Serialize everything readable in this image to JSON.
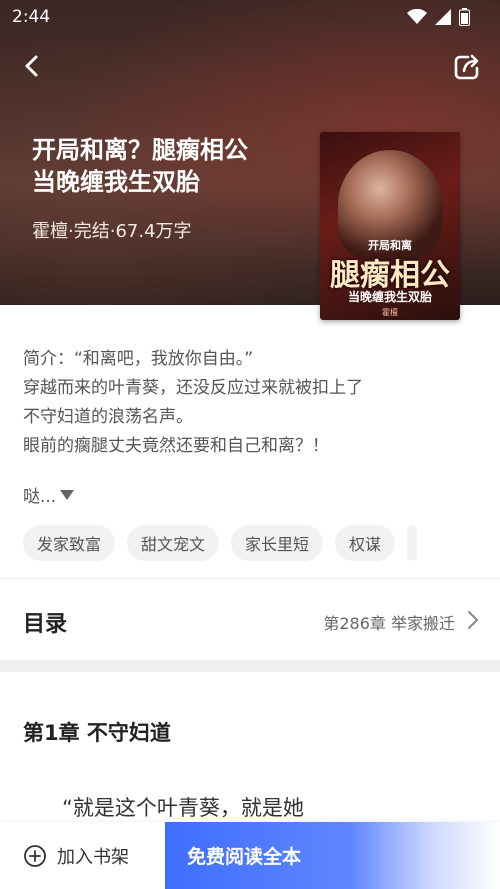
{
  "status_bar": {
    "time": "2:44"
  },
  "book": {
    "title_line1": "开局和离？腿瘸相公",
    "title_line2": "当晚缠我生双胎",
    "meta": "霍檀·完结·67.4万字",
    "cover": {
      "text_top": "开局和离",
      "text_main": "腿瘸相公",
      "text_sub": "当晚缠我生双胎",
      "author_mark": "霍檀"
    }
  },
  "synopsis": {
    "lines": [
      "简介：“和离吧，我放你自由。”",
      "穿越而来的叶青葵，还没反应过来就被扣上了",
      "不守妇道的浪荡名声。",
      "眼前的瘸腿丈夫竟然还要和自己和离？！"
    ],
    "more": "哒..."
  },
  "tags": [
    "发家致富",
    "甜文宠文",
    "家长里短",
    "权谋"
  ],
  "toc": {
    "label": "目录",
    "latest_chapter": "第286章 举家搬迁"
  },
  "chapter": {
    "title": "第1章 不守妇道",
    "first_line": "“就是这个叶青葵，就是她"
  },
  "bottom_bar": {
    "add_to_shelf": "加入书架",
    "read_button": "免费阅读全本"
  },
  "colors": {
    "accent": "#4a76ff",
    "hero_bg": "#4b2f2a"
  }
}
